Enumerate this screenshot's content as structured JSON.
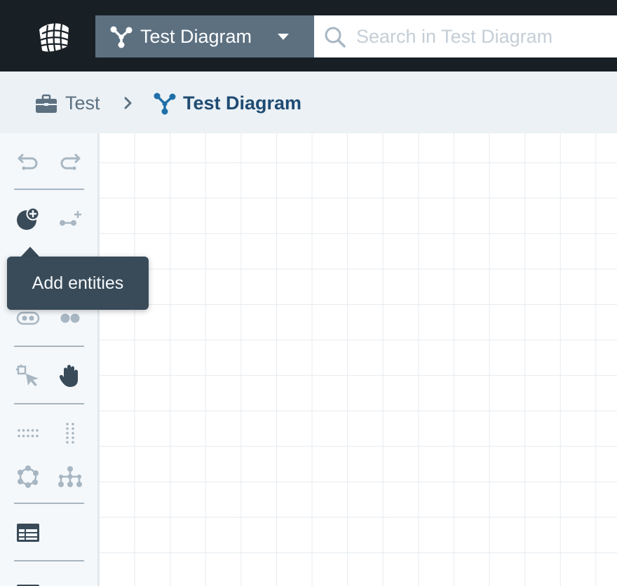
{
  "header": {
    "logo_icon": "globe-grid-logo",
    "diagram_select": {
      "label": "Test Diagram",
      "icon": "diagram-nodes-icon"
    },
    "search": {
      "placeholder": "Search in Test Diagram",
      "value": ""
    }
  },
  "breadcrumb": {
    "items": [
      {
        "label": "Test",
        "icon": "briefcase-icon"
      },
      {
        "label": "Test Diagram",
        "icon": "diagram-nodes-icon"
      }
    ]
  },
  "toolbar": {
    "tools": [
      "undo",
      "redo",
      "add-entities",
      "add-link",
      "show-labels",
      "collapse-nodes",
      "select",
      "pan",
      "grid-layout",
      "vertical-layout",
      "circle-layout",
      "hierarchy-layout",
      "table-view"
    ]
  },
  "tooltip": {
    "text": "Add entities"
  },
  "colors": {
    "topbar": "#182026",
    "select_bg": "#5c7080",
    "breadcrumb_bg": "#ebf1f5",
    "accent": "#1f4b73",
    "tooltip_bg": "#394b59",
    "icon_muted": "#a7b6c2",
    "icon_dark": "#394b59"
  }
}
